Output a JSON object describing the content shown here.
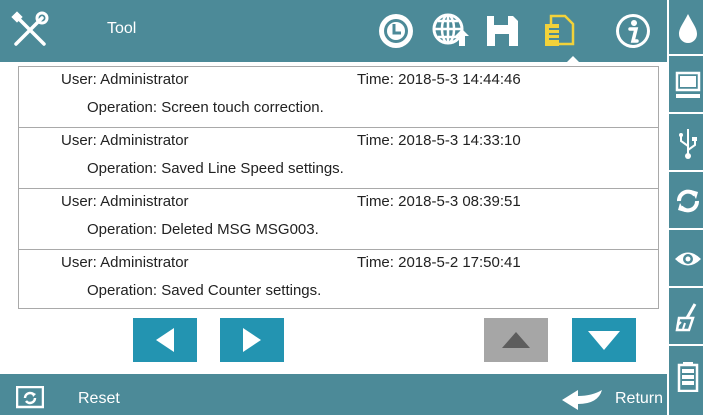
{
  "header": {
    "title": "Tool",
    "icons": [
      "tools-icon",
      "clock-icon",
      "globe-upload-icon",
      "save-icon",
      "log-document-icon",
      "info-icon"
    ],
    "active_icon": "log-document-icon"
  },
  "sidebar": {
    "items": [
      {
        "icon": "ink-drop-icon"
      },
      {
        "icon": "monitor-icon"
      },
      {
        "icon": "usb-icon"
      },
      {
        "icon": "refresh-icon"
      },
      {
        "icon": "eye-icon"
      },
      {
        "icon": "clean-brush-icon"
      },
      {
        "icon": "battery-icon"
      }
    ]
  },
  "log": {
    "entries": [
      {
        "user": "User: Administrator",
        "time": "Time: 2018-5-3 14:44:46",
        "operation": "Operation: Screen touch correction."
      },
      {
        "user": "User: Administrator",
        "time": "Time: 2018-5-3 14:33:10",
        "operation": "Operation: Saved Line Speed settings."
      },
      {
        "user": "User: Administrator",
        "time": "Time: 2018-5-3 08:39:51",
        "operation": "Operation: Deleted MSG MSG003."
      },
      {
        "user": "User: Administrator",
        "time": "Time: 2018-5-2 17:50:41",
        "operation": "Operation: Saved Counter settings."
      }
    ]
  },
  "navigation": {
    "prev_enabled": true,
    "next_enabled": true,
    "up_enabled": false,
    "down_enabled": true
  },
  "footer": {
    "reset_label": "Reset",
    "return_label": "Return"
  },
  "colors": {
    "bar": "#4c8a98",
    "button": "#2394b1",
    "button_disabled": "#a6a6a6",
    "active_icon": "#f2d23a"
  }
}
